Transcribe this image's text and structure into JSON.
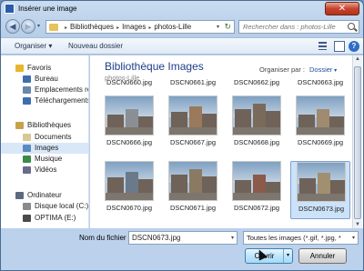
{
  "window": {
    "title": "Insérer une image",
    "close_symbol": "✕"
  },
  "nav": {
    "back_symbol": "◀",
    "forward_symbol": "▶",
    "breadcrumbs": [
      "Bibliothèques",
      "Images",
      "photos-Lille"
    ],
    "crumb_separator": "▸",
    "search_placeholder": "Rechercher dans : photos-Lille"
  },
  "toolbar": {
    "organize_label": "Organiser ▾",
    "new_folder_label": "Nouveau dossier",
    "help_symbol": "?"
  },
  "sidebar": {
    "items": [
      {
        "label": "Favoris",
        "icon": "star-icon",
        "color": "#e8b62a",
        "level": 0
      },
      {
        "label": "Bureau",
        "icon": "desktop-icon",
        "color": "#3d6fb0",
        "level": 1
      },
      {
        "label": "Emplacements re",
        "icon": "recent-places-icon",
        "color": "#6a86aa",
        "level": 1
      },
      {
        "label": "Téléchargements",
        "icon": "downloads-icon",
        "color": "#3d6fb0",
        "level": 1
      },
      {
        "label": "Bibliothèques",
        "icon": "libraries-icon",
        "color": "#c8a24a",
        "level": 0
      },
      {
        "label": "Documents",
        "icon": "documents-icon",
        "color": "#d9c796",
        "level": 1
      },
      {
        "label": "Images",
        "icon": "pictures-icon",
        "color": "#5a8ac0",
        "level": 1,
        "selected": true
      },
      {
        "label": "Musique",
        "icon": "music-icon",
        "color": "#3a8a4a",
        "level": 1
      },
      {
        "label": "Vidéos",
        "icon": "videos-icon",
        "color": "#6a6a8a",
        "level": 1
      },
      {
        "label": "Ordinateur",
        "icon": "computer-icon",
        "color": "#5a6a80",
        "level": 0
      },
      {
        "label": "Disque local (C:)",
        "icon": "disk-icon",
        "color": "#8a8a8a",
        "level": 1
      },
      {
        "label": "OPTIMA (E:)",
        "icon": "drive-icon",
        "color": "#4a4a4a",
        "level": 1
      }
    ]
  },
  "library": {
    "title": "Bibliothèque Images",
    "subtitle": "photos-Lille",
    "arrange_label": "Organiser par :",
    "arrange_value": "Dossier"
  },
  "files": {
    "top_row_partial": [
      "DSCN0660.jpg",
      "DSCN0661.jpg",
      "DSCN0662.jpg",
      "DSCN0663.jpg"
    ],
    "tiles": [
      {
        "name": "DSCN0666.jpg"
      },
      {
        "name": "DSCN0667.jpg"
      },
      {
        "name": "DSCN0668.jpg"
      },
      {
        "name": "DSCN0669.jpg"
      },
      {
        "name": "DSCN0670.jpg"
      },
      {
        "name": "DSCN0671.jpg"
      },
      {
        "name": "DSCN0672.jpg"
      },
      {
        "name": "DSCN0673.jpg",
        "selected": true
      }
    ]
  },
  "footer": {
    "filename_label": "Nom du fichier :",
    "filename_value": "DSCN0673.jpg",
    "filter_value": "Toutes les images (*.gif, *.jpg, *",
    "open_label": "Ouvrir",
    "cancel_label": "Annuler"
  }
}
